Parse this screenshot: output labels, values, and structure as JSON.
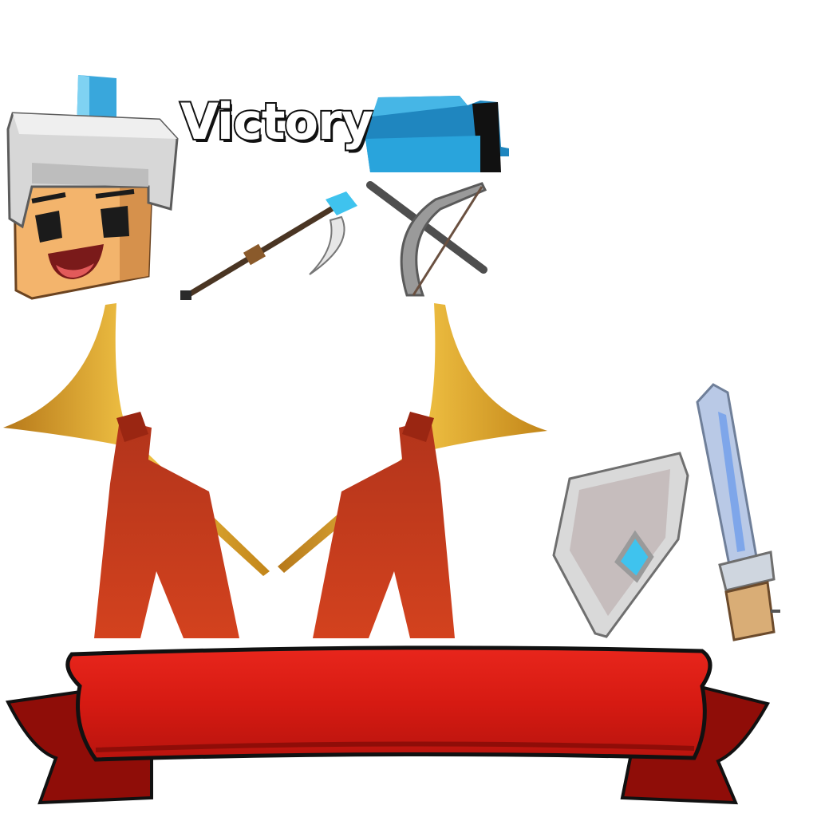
{
  "victory": {
    "label": "Victory"
  },
  "assets": {
    "hero": "hero-head-icon",
    "hat": "blue-hat-icon",
    "scythe": "scythe-icon",
    "crossbow": "crossbow-icon",
    "trumpets": "trumpet-icon",
    "shield": "shield-icon",
    "sword": "sword-icon",
    "banner": "ribbon-banner-icon"
  },
  "colors": {
    "banner_red": "#d81d14",
    "banner_dark": "#8f0d08",
    "trumpet_gold": "#e0a626",
    "drape_red": "#c43a1e",
    "gem_blue": "#3fc3ee",
    "helmet_grey": "#c9c9c9",
    "skin": "#f3b46c"
  }
}
